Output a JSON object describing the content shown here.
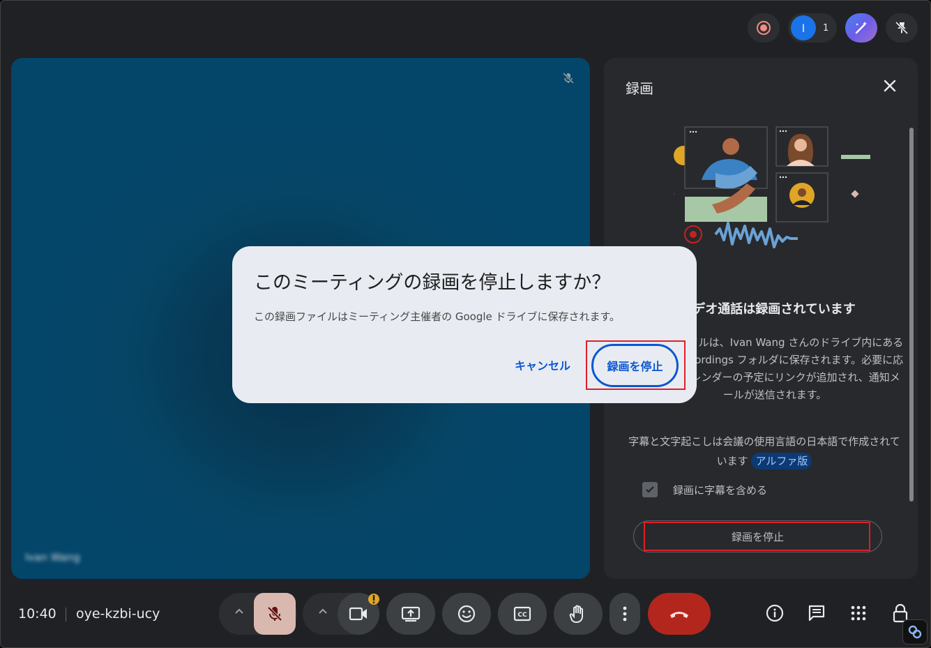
{
  "top_bar": {
    "participants_count": "1",
    "avatar_initial": "I"
  },
  "tile": {
    "participant_name": "Ivan Wang"
  },
  "panel": {
    "title": "録画",
    "heading": "ビデオ通話は録画されています",
    "description": "録画ファイルは、Ivan Wang さんのドライブ内にある Meet Recordings フォルダに保存されます。必要に応じて、カレンダーの予定にリンクが追加され、通知メールが送信されます。",
    "caption_text": "字幕と文字起こしは会議の使用言語の日本語で作成されています",
    "alpha_badge": "アルファ版",
    "include_captions_label": "録画に字幕を含める",
    "include_captions_checked": true,
    "stop_button": "録画を停止"
  },
  "modal": {
    "title": "このミーティングの録画を停止しますか？",
    "body": "この録画ファイルはミーティング主催者の Google ドライブに保存されます。",
    "cancel": "キャンセル",
    "confirm": "録画を停止"
  },
  "bottom_bar": {
    "time": "10:40",
    "meeting_code": "oye-kzbi-ucy"
  },
  "colors": {
    "accent": "#0b57d0",
    "end_call": "#b3261e",
    "highlight": "#e01e2a"
  }
}
